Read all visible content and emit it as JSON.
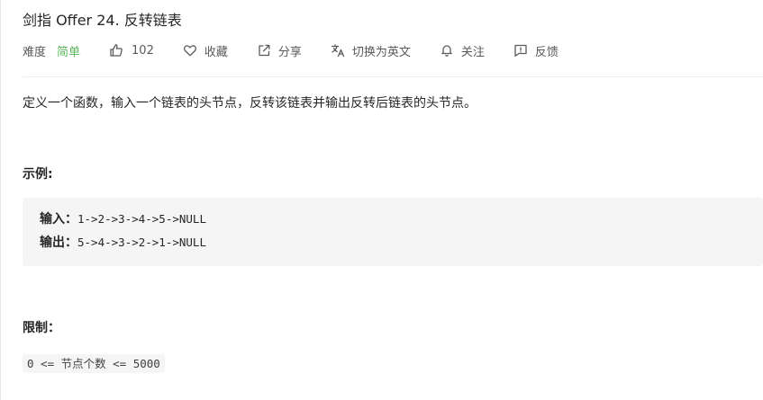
{
  "problem": {
    "title": "剑指 Offer 24. 反转链表",
    "difficulty_label": "难度",
    "difficulty_value": "简单",
    "difficulty_color": "#5cb85c"
  },
  "actions": {
    "like_count": "102",
    "favorite_label": "收藏",
    "share_label": "分享",
    "translate_label": "切换为英文",
    "follow_label": "关注",
    "feedback_label": "反馈"
  },
  "content": {
    "description": "定义一个函数，输入一个链表的头节点，反转该链表并输出反转后链表的头节点。",
    "example_heading": "示例:",
    "example": {
      "input_label": "输入：",
      "input_value": "1->2->3->4->5->NULL",
      "output_label": "输出：",
      "output_value": "5->4->3->2->1->NULL"
    },
    "constraints_heading": "限制：",
    "constraint": "0 <= 节点个数 <= 5000"
  },
  "icons": {
    "like": "thumbs-up-icon",
    "favorite": "heart-icon",
    "share": "share-icon",
    "translate": "translate-icon",
    "follow": "bell-icon",
    "feedback": "feedback-icon"
  }
}
